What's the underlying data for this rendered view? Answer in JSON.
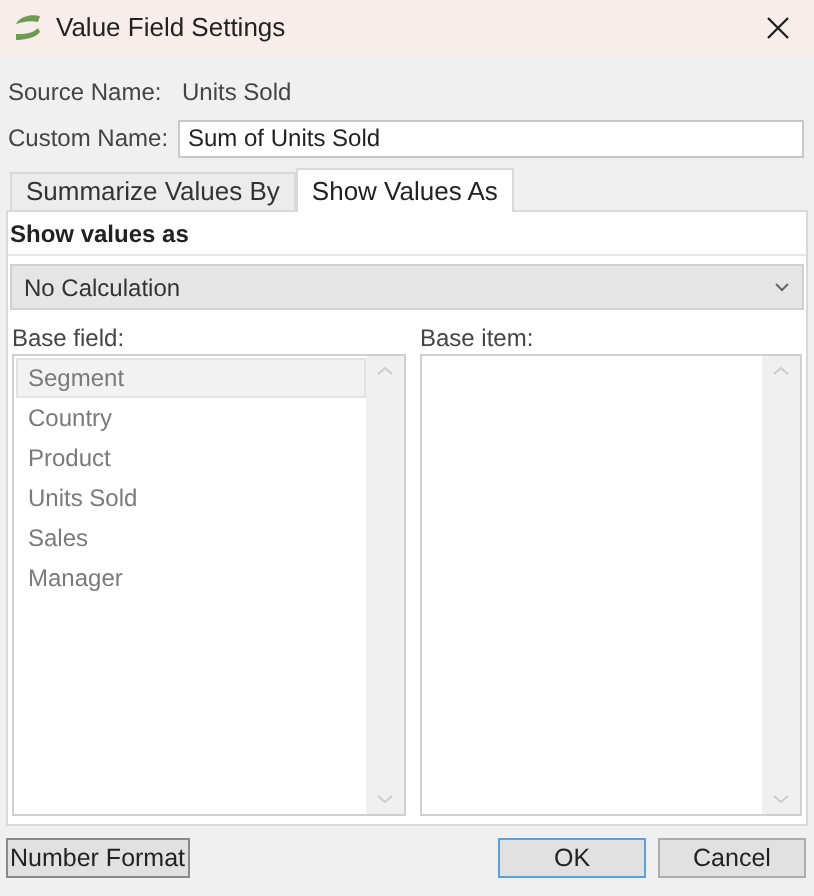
{
  "window": {
    "title": "Value Field Settings"
  },
  "source_name": {
    "label": "Source Name:",
    "value": "Units Sold"
  },
  "custom_name": {
    "label": "Custom Name:",
    "value": "Sum of Units Sold"
  },
  "tabs": [
    {
      "label": "Summarize Values By",
      "selected": false
    },
    {
      "label": "Show Values As",
      "selected": true
    }
  ],
  "show_values_as": {
    "heading": "Show values as",
    "dropdown": {
      "value": "No Calculation"
    }
  },
  "base_field": {
    "label": "Base field:",
    "disabled": true,
    "items": [
      {
        "label": "Segment",
        "selected": true
      },
      {
        "label": "Country",
        "selected": false
      },
      {
        "label": "Product",
        "selected": false
      },
      {
        "label": "Units Sold",
        "selected": false
      },
      {
        "label": "Sales",
        "selected": false
      },
      {
        "label": "Manager",
        "selected": false
      }
    ]
  },
  "base_item": {
    "label": "Base item:"
  },
  "buttons": [
    {
      "label": "Number Format",
      "kind": "left"
    },
    {
      "label": "OK",
      "kind": "default"
    },
    {
      "label": "Cancel",
      "kind": "normal"
    }
  ]
}
